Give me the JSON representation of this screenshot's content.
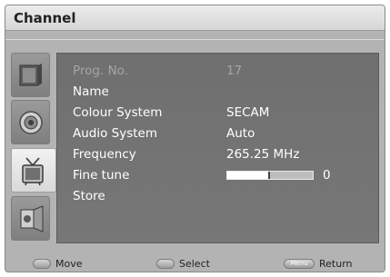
{
  "window": {
    "title": "Channel"
  },
  "sidebar": {
    "items": [
      {
        "name": "picture",
        "icon": "tv-screen-icon"
      },
      {
        "name": "sound",
        "icon": "speaker-icon"
      },
      {
        "name": "channel",
        "icon": "antenna-tv-icon",
        "active": true
      },
      {
        "name": "setup",
        "icon": "setup-icon"
      }
    ]
  },
  "menu": {
    "rows": [
      {
        "label": "Prog. No.",
        "value": "17",
        "enabled": false
      },
      {
        "label": "Name",
        "value": ""
      },
      {
        "label": "Colour System",
        "value": "SECAM"
      },
      {
        "label": "Audio System",
        "value": "Auto"
      },
      {
        "label": "Frequency",
        "value": "265.25 MHz"
      },
      {
        "label": "Fine tune",
        "value": "0",
        "slider_level": 0.5
      },
      {
        "label": "Store",
        "value": ""
      }
    ]
  },
  "footer": {
    "move": {
      "key": "",
      "label": "Move"
    },
    "select": {
      "key": "",
      "label": "Select"
    },
    "return": {
      "key": "Menu",
      "label": "Return"
    }
  }
}
